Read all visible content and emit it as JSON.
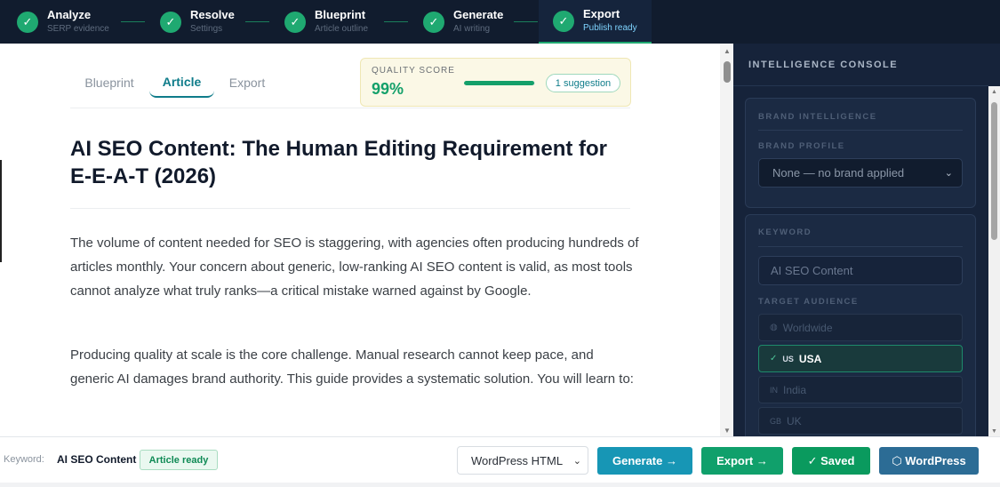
{
  "steps": [
    {
      "title": "Analyze",
      "subtitle": "SERP evidence",
      "state": "done"
    },
    {
      "title": "Resolve",
      "subtitle": "Settings",
      "state": "done"
    },
    {
      "title": "Blueprint",
      "subtitle": "Article outline",
      "state": "done"
    },
    {
      "title": "Generate",
      "subtitle": "AI writing",
      "state": "done"
    },
    {
      "title": "Export",
      "subtitle": "Publish ready",
      "state": "active"
    }
  ],
  "check_glyph": "✓",
  "tabs": [
    {
      "label": "Blueprint"
    },
    {
      "label": "Article"
    },
    {
      "label": "Export"
    }
  ],
  "quality": {
    "label": "QUALITY SCORE",
    "value": "99%",
    "fill_fraction": 0.99,
    "suggestion": "1 suggestion"
  },
  "article": {
    "title": "AI SEO Content: The Human Editing Requirement for E-E-A-T (2026)",
    "paragraphs": [
      "The volume of content needed for SEO is staggering, with agencies often producing hundreds of articles monthly. Your concern about generic, low-ranking AI SEO content is valid, as most tools cannot analyze what truly ranks—a critical mistake warned against by Google.",
      "Producing quality at scale is the core challenge. Manual research cannot keep pace, and generic AI damages brand authority. This guide provides a systematic solution. You will learn to:"
    ]
  },
  "console": {
    "heading": "INTELLIGENCE CONSOLE",
    "brand_section": "BRAND INTELLIGENCE",
    "brand_profile_label": "BRAND PROFILE",
    "brand_profile_value": "None — no brand applied",
    "keyword_section": "KEYWORD",
    "keyword_value": "AI SEO Content",
    "audience_label": "TARGET AUDIENCE",
    "audiences": [
      {
        "icon": "◍",
        "code": "",
        "label": "Worldwide",
        "selected": false
      },
      {
        "icon": "✓",
        "code": "US",
        "label": "USA",
        "selected": true
      },
      {
        "icon": "",
        "code": "IN",
        "label": "India",
        "selected": false
      },
      {
        "icon": "",
        "code": "GB",
        "label": "UK",
        "selected": false
      }
    ]
  },
  "bottom": {
    "keyword_label": "Keyword:",
    "keyword_value": "AI SEO Content",
    "status": "Article ready",
    "format_value": "WordPress HTML",
    "generate_label": "Generate →",
    "export_label": "Export →",
    "saved_label": "✓ Saved",
    "wordpress_label": "⬡ WordPress"
  },
  "colors": {
    "accent_green": "#1fa971",
    "teal": "#0f7c8a",
    "nav_bg": "#111c2e",
    "console_bg": "#16233a"
  }
}
